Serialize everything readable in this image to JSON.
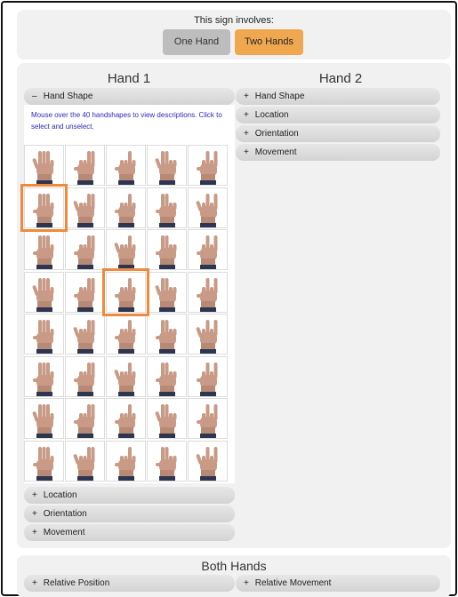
{
  "involves": {
    "label": "This sign involves:",
    "one_hand": "One Hand",
    "two_hands": "Two Hands",
    "selected": "Two Hands",
    "accent": "#f0a850"
  },
  "hand1": {
    "title": "Hand 1",
    "hand_shape": {
      "sign": "–",
      "label": "Hand Shape",
      "expanded": true
    },
    "description": "Mouse over the 40 handshapes to view descriptions. Click to select and unselect.",
    "handshape_count": 40,
    "selected_handshapes": [
      5,
      17
    ],
    "location": {
      "sign": "+",
      "label": "Location"
    },
    "orientation": {
      "sign": "+",
      "label": "Orientation"
    },
    "movement": {
      "sign": "+",
      "label": "Movement"
    }
  },
  "hand2": {
    "title": "Hand 2",
    "hand_shape": {
      "sign": "+",
      "label": "Hand Shape"
    },
    "location": {
      "sign": "+",
      "label": "Location"
    },
    "orientation": {
      "sign": "+",
      "label": "Orientation"
    },
    "movement": {
      "sign": "+",
      "label": "Movement"
    }
  },
  "both": {
    "title": "Both Hands",
    "relative_position": {
      "sign": "+",
      "label": "Relative Position"
    },
    "relative_movement": {
      "sign": "+",
      "label": "Relative Movement"
    }
  },
  "selection_color": "#ef8a3a"
}
